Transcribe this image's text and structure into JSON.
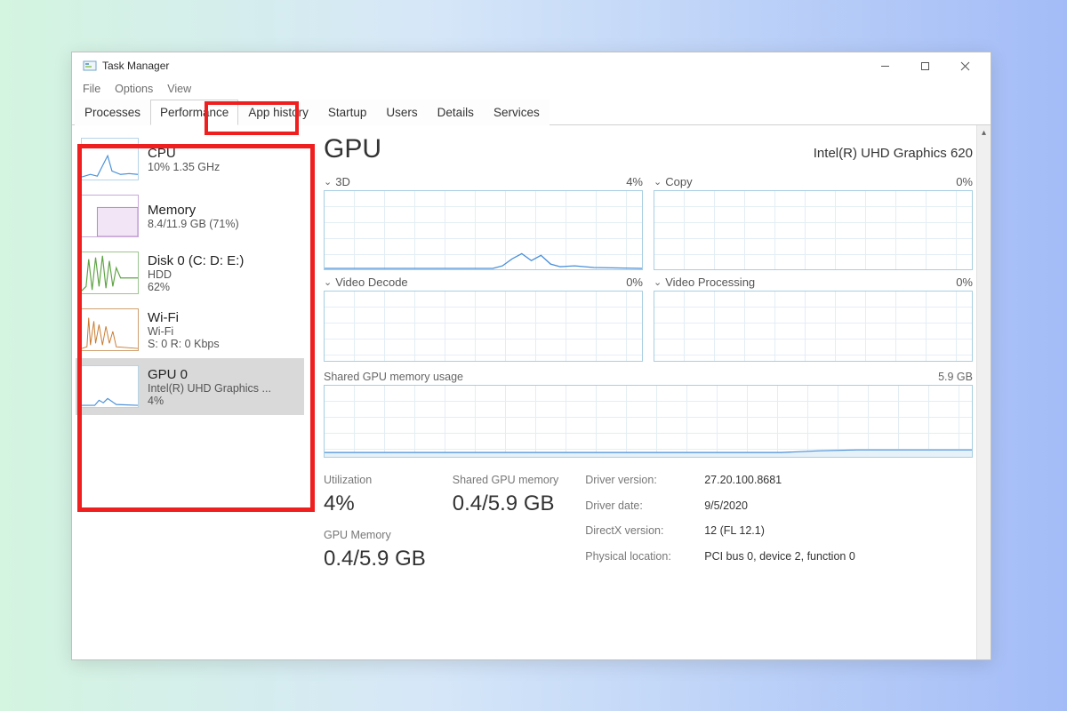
{
  "window": {
    "title": "Task Manager"
  },
  "menu": [
    "File",
    "Options",
    "View"
  ],
  "tabs": [
    "Processes",
    "Performance",
    "App history",
    "Startup",
    "Users",
    "Details",
    "Services"
  ],
  "sidebar": {
    "items": [
      {
        "title": "CPU",
        "sub1": "10%  1.35 GHz",
        "sub2": ""
      },
      {
        "title": "Memory",
        "sub1": "8.4/11.9 GB (71%)",
        "sub2": ""
      },
      {
        "title": "Disk 0 (C: D: E:)",
        "sub1": "HDD",
        "sub2": "62%"
      },
      {
        "title": "Wi-Fi",
        "sub1": "Wi-Fi",
        "sub2": "S: 0  R: 0 Kbps"
      },
      {
        "title": "GPU 0",
        "sub1": "Intel(R) UHD Graphics ...",
        "sub2": "4%"
      }
    ]
  },
  "main": {
    "title": "GPU",
    "subtitle": "Intel(R) UHD Graphics 620",
    "graphs": [
      {
        "label": "3D",
        "pct": "4%"
      },
      {
        "label": "Copy",
        "pct": "0%"
      },
      {
        "label": "Video Decode",
        "pct": "0%"
      },
      {
        "label": "Video Processing",
        "pct": "0%"
      }
    ],
    "shared": {
      "label": "Shared GPU memory usage",
      "right": "5.9 GB"
    },
    "stats": {
      "utilization_label": "Utilization",
      "utilization_value": "4%",
      "shared_label": "Shared GPU memory",
      "shared_value": "0.4/5.9 GB",
      "mem_label": "GPU Memory",
      "mem_value": "0.4/5.9 GB"
    },
    "info": [
      {
        "k": "Driver version:",
        "v": "27.20.100.8681"
      },
      {
        "k": "Driver date:",
        "v": "9/5/2020"
      },
      {
        "k": "DirectX version:",
        "v": "12 (FL 12.1)"
      },
      {
        "k": "Physical location:",
        "v": "PCI bus 0, device 2, function 0"
      }
    ]
  },
  "chart_data": [
    {
      "type": "line",
      "title": "CPU thumbnail",
      "ylim": [
        0,
        100
      ],
      "values": [
        5,
        8,
        6,
        30,
        45,
        12,
        8,
        10,
        9
      ]
    },
    {
      "type": "area",
      "title": "Memory thumbnail",
      "ylim": [
        0,
        100
      ],
      "values": [
        70,
        70,
        71,
        71,
        71,
        71,
        71,
        71
      ]
    },
    {
      "type": "line",
      "title": "Disk thumbnail",
      "ylim": [
        0,
        100
      ],
      "values": [
        10,
        80,
        20,
        95,
        30,
        85,
        40,
        62,
        55
      ]
    },
    {
      "type": "line",
      "title": "Wi-Fi thumbnail",
      "ylim": [
        0,
        100
      ],
      "values": [
        2,
        60,
        10,
        55,
        8,
        50,
        12,
        40,
        6
      ]
    },
    {
      "type": "line",
      "title": "GPU thumbnail",
      "ylim": [
        0,
        100
      ],
      "values": [
        2,
        3,
        2,
        12,
        8,
        4,
        3,
        4,
        3
      ]
    },
    {
      "type": "line",
      "title": "3D engine",
      "ylim": [
        0,
        100
      ],
      "values": [
        0,
        0,
        0,
        0,
        0,
        0,
        0,
        2,
        9,
        14,
        8,
        12,
        5,
        2,
        3,
        1,
        1,
        0,
        0
      ]
    },
    {
      "type": "line",
      "title": "Copy engine",
      "ylim": [
        0,
        100
      ],
      "values": [
        0,
        0,
        0,
        0,
        0,
        0,
        0,
        0,
        0,
        0,
        0,
        0,
        0,
        0
      ]
    },
    {
      "type": "line",
      "title": "Video Decode engine",
      "ylim": [
        0,
        100
      ],
      "values": [
        0,
        0,
        0,
        0,
        0,
        0,
        0,
        0,
        0,
        0,
        0,
        0,
        0,
        0
      ]
    },
    {
      "type": "line",
      "title": "Video Processing engine",
      "ylim": [
        0,
        100
      ],
      "values": [
        0,
        0,
        0,
        0,
        0,
        0,
        0,
        0,
        0,
        0,
        0,
        0,
        0,
        0
      ]
    },
    {
      "type": "area",
      "title": "Shared GPU memory usage",
      "ylim": [
        0,
        5.9
      ],
      "values": [
        0.35,
        0.35,
        0.35,
        0.35,
        0.35,
        0.35,
        0.35,
        0.35,
        0.35,
        0.35,
        0.38,
        0.4,
        0.4,
        0.4
      ]
    }
  ]
}
